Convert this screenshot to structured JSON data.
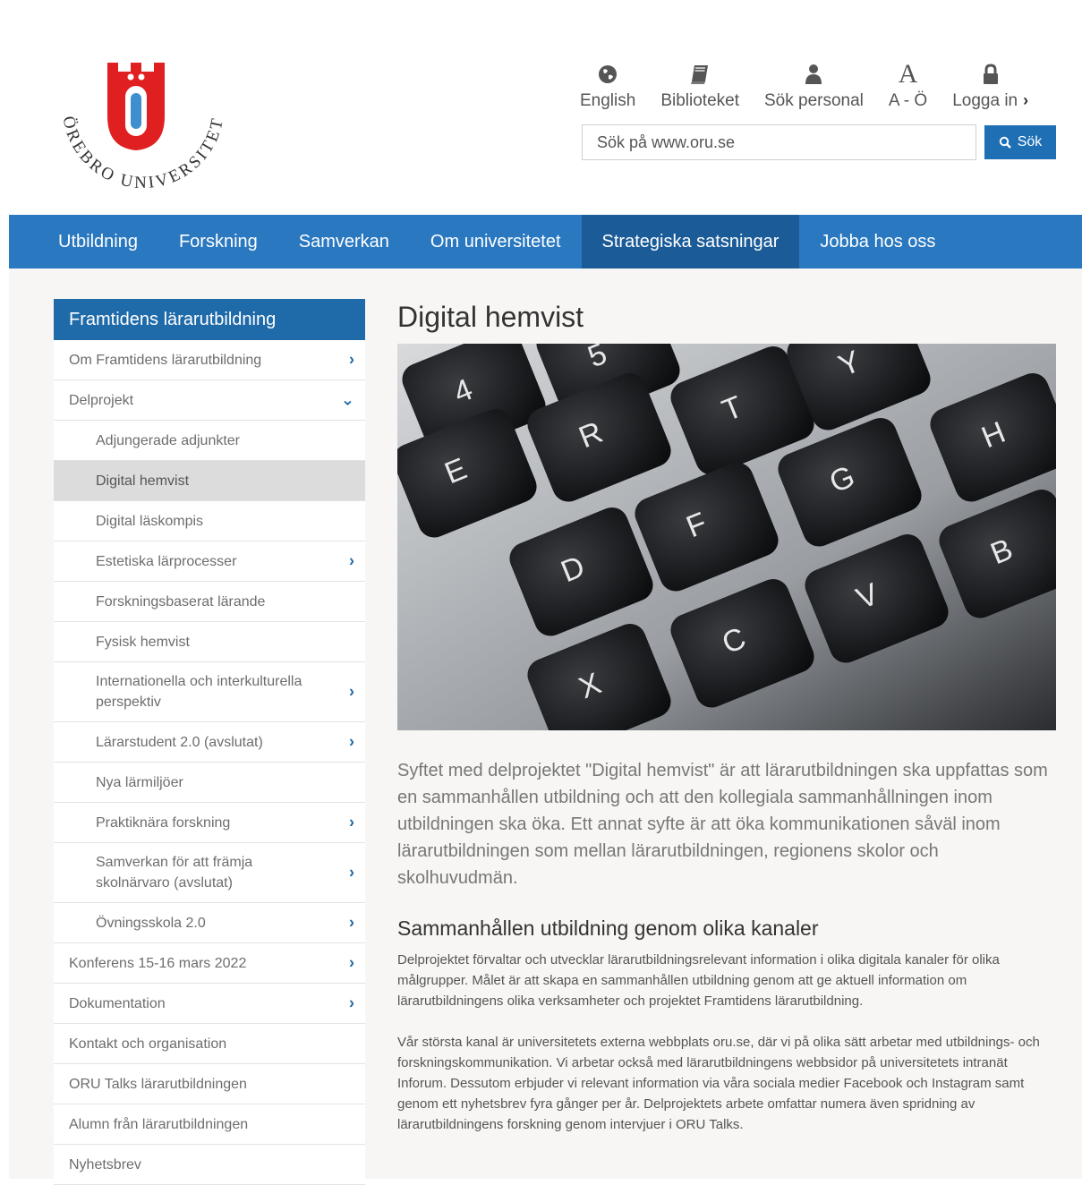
{
  "logo": {
    "text": "ÖREBRO UNIVERSITET",
    "letter": "Ö",
    "color": "#e02020"
  },
  "toplinks": [
    {
      "label": "English",
      "icon": "globe-icon"
    },
    {
      "label": "Biblioteket",
      "icon": "book-icon"
    },
    {
      "label": "Sök personal",
      "icon": "person-icon"
    },
    {
      "label": "A - Ö",
      "icon": "a-letter-icon"
    },
    {
      "label": "Logga in",
      "icon": "lock-icon"
    }
  ],
  "search": {
    "placeholder": "Sök på www.oru.se",
    "button_label": "Sök"
  },
  "nav": {
    "items": [
      "Utbildning",
      "Forskning",
      "Samverkan",
      "Om universitetet",
      "Strategiska satsningar",
      "Jobba hos oss"
    ],
    "active": "Strategiska satsningar"
  },
  "sidebar": {
    "title": "Framtidens lärarutbildning",
    "items": [
      {
        "label": "Om Framtidens lärarutbildning",
        "level": 1,
        "arrow": "›"
      },
      {
        "label": "Delprojekt",
        "level": 1,
        "arrow": "⌄"
      },
      {
        "label": "Adjungerade adjunkter",
        "level": 2,
        "arrow": ""
      },
      {
        "label": "Digital hemvist",
        "level": 2,
        "arrow": "",
        "selected": true
      },
      {
        "label": "Digital läskompis",
        "level": 2,
        "arrow": ""
      },
      {
        "label": "Estetiska lärprocesser",
        "level": 2,
        "arrow": "›"
      },
      {
        "label": "Forskningsbaserat lärande",
        "level": 2,
        "arrow": ""
      },
      {
        "label": "Fysisk hemvist",
        "level": 2,
        "arrow": ""
      },
      {
        "label": "Internationella och interkulturella perspektiv",
        "level": 2,
        "arrow": "›"
      },
      {
        "label": "Lärarstudent 2.0 (avslutat)",
        "level": 2,
        "arrow": "›"
      },
      {
        "label": "Nya lärmiljöer",
        "level": 2,
        "arrow": ""
      },
      {
        "label": "Praktiknära forskning",
        "level": 2,
        "arrow": "›"
      },
      {
        "label": "Samverkan för att främja skolnärvaro (avslutat)",
        "level": 2,
        "arrow": "›"
      },
      {
        "label": "Övningsskola 2.0",
        "level": 2,
        "arrow": "›"
      },
      {
        "label": "Konferens 15-16 mars 2022",
        "level": 1,
        "arrow": "›"
      },
      {
        "label": "Dokumentation",
        "level": 1,
        "arrow": "›"
      },
      {
        "label": "Kontakt och organisation",
        "level": 1,
        "arrow": ""
      },
      {
        "label": "ORU Talks lärarutbildningen",
        "level": 1,
        "arrow": ""
      },
      {
        "label": "Alumn från lärarutbildningen",
        "level": 1,
        "arrow": ""
      },
      {
        "label": "Nyhetsbrev",
        "level": 1,
        "arrow": ""
      }
    ]
  },
  "content": {
    "title": "Digital hemvist",
    "hero_keys": [
      "4",
      "5",
      "T",
      "Y",
      "E",
      "R",
      "G",
      "H",
      "F",
      "D",
      "B",
      "V",
      "C",
      "X"
    ],
    "lead": "Syftet med delprojektet \"Digital hemvist\" är att lärarutbildningen ska uppfattas som en sammanhållen utbildning och att den kollegiala sammanhållningen inom utbildningen ska öka. Ett annat syfte är att öka kommunikationen såväl inom lärarutbildningen som mellan lärarutbildningen, regionens skolor och skolhuvudmän.",
    "section_title": "Sammanhållen utbildning genom olika kanaler",
    "paragraphs": [
      "Delprojektet förvaltar och utvecklar lärarutbildningsrelevant information i olika digitala kanaler för olika målgrupper. Målet är att skapa en sammanhållen utbildning genom att ge aktuell information om lärarutbildningens olika verksamheter och projektet Framtidens lärarutbildning.",
      "Vår största kanal är universitetets externa webbplats oru.se, där vi på olika sätt arbetar med utbildnings- och forskningskommunikation. Vi arbetar också med lärarutbildningens webbsidor på universitetets intranät Inforum. Dessutom erbjuder vi relevant information via våra sociala medier Facebook och Instagram samt genom ett nyhetsbrev fyra gånger per år. Delprojektets arbete omfattar numera även spridning av lärarutbildningens forskning genom intervjuer i ORU Talks."
    ]
  },
  "colors": {
    "nav_bg": "#2a78c0",
    "nav_active": "#1b5c98",
    "sidebar_head": "#1f6aa9",
    "accent": "#1f6fb5"
  }
}
